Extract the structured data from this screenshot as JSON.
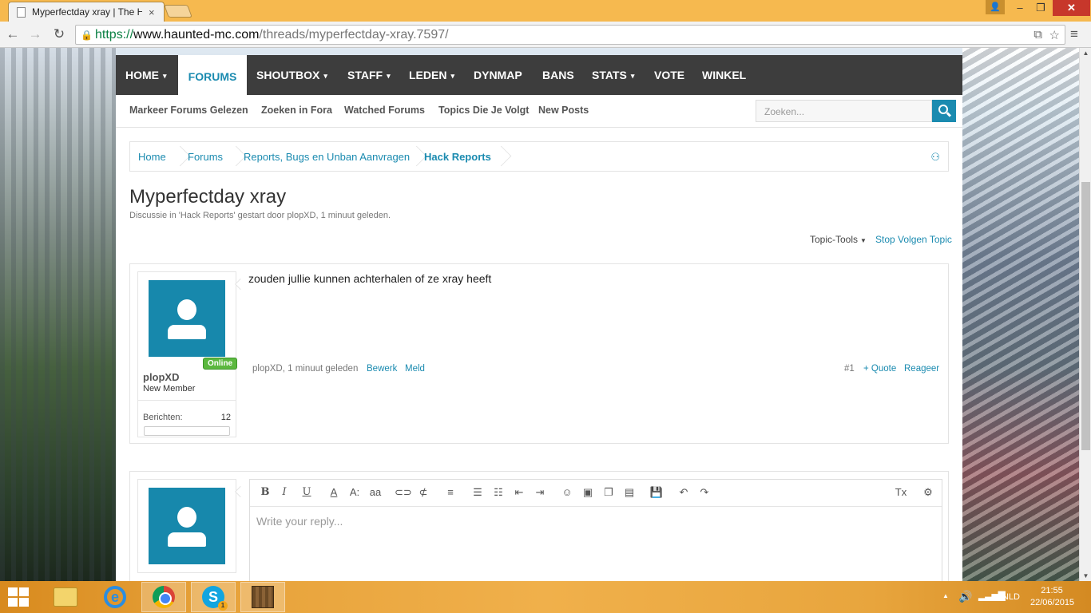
{
  "browser": {
    "tab_title": "Myperfectday xray | The H",
    "tab_close": "×",
    "url_scheme": "https://",
    "url_host": "www.haunted-mc.com",
    "url_path": "/threads/myperfectday-xray.7597/",
    "window_buttons": {
      "minimize": "–",
      "maximize": "❐",
      "close": "✕"
    }
  },
  "nav": {
    "tabs": [
      {
        "label": "HOME",
        "caret": "▾"
      },
      {
        "label": "FORUMS"
      },
      {
        "label": "SHOUTBOX",
        "caret": "▾"
      },
      {
        "label": "STAFF",
        "caret": "▾"
      },
      {
        "label": "LEDEN",
        "caret": "▾"
      },
      {
        "label": "DYNMAP"
      },
      {
        "label": "BANS"
      },
      {
        "label": "STATS",
        "caret": "▾"
      },
      {
        "label": "VOTE"
      },
      {
        "label": "WINKEL"
      }
    ],
    "active_tab": "FORUMS"
  },
  "subnav": {
    "links": [
      "Markeer Forums Gelezen",
      "Zoeken in Fora",
      "Watched Forums",
      "Topics Die Je Volgt",
      "New Posts"
    ],
    "search_placeholder": "Zoeken..."
  },
  "breadcrumb": [
    "Home",
    "Forums",
    "Reports, Bugs en Unban Aanvragen",
    "Hack Reports"
  ],
  "thread": {
    "title": "Myperfectday xray",
    "meta": "Discussie in 'Hack Reports' gestart door plopXD, 1 minuut geleden.",
    "topic_tools": "Topic-Tools",
    "stop_follow": "Stop Volgen Topic"
  },
  "post": {
    "author": "plopXD",
    "user_title": "New Member",
    "online_label": "Online",
    "stat_label": "Berichten:",
    "stat_value": "12",
    "body": "zouden jullie kunnen achterhalen of ze xray heeft",
    "footer_author_time": "plopXD, 1 minuut geleden",
    "edit": "Bewerk",
    "report": "Meld",
    "number": "#1",
    "quote": "+ Quote",
    "reply": "Reageer"
  },
  "editor": {
    "placeholder": "Write your reply..."
  },
  "taskbar": {
    "clock_time": "21:55",
    "clock_date": "22/06/2015",
    "language": "NLD",
    "skype_badge": "1"
  },
  "colors": {
    "accent": "#1b8bb0",
    "navbar": "#3d3d3d",
    "online_badge": "#5bb83f",
    "chrome_frame": "#f6b94f"
  }
}
